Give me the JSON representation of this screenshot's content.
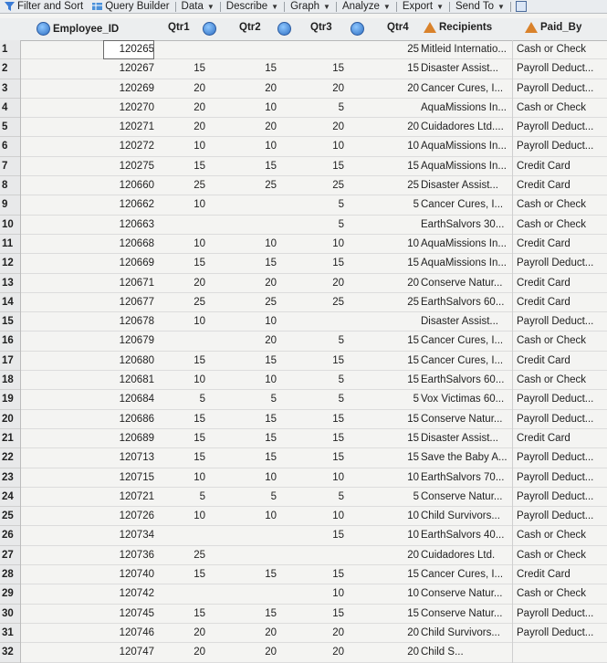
{
  "toolbar": {
    "items": [
      "Filter and Sort",
      "Query Builder",
      "Data",
      "Describe",
      "Graph",
      "Analyze",
      "Export",
      "Send To"
    ],
    "icons": [
      "filter-icon",
      "query-builder-icon",
      "",
      "",
      "",
      "",
      "",
      "",
      "window-icon"
    ]
  },
  "columns": [
    "Employee_ID",
    "Qtr1",
    "Qtr2",
    "Qtr3",
    "Qtr4",
    "Recipients",
    "Paid_By"
  ],
  "rows": [
    {
      "n": "1",
      "emp": "120265",
      "q1": "",
      "q2": "",
      "q3": "",
      "q4": "25",
      "rec": "Mitleid Internatio...",
      "paid": "Cash or Check"
    },
    {
      "n": "2",
      "emp": "120267",
      "q1": "15",
      "q2": "15",
      "q3": "15",
      "q4": "15",
      "rec": "Disaster Assist...",
      "paid": "Payroll Deduct..."
    },
    {
      "n": "3",
      "emp": "120269",
      "q1": "20",
      "q2": "20",
      "q3": "20",
      "q4": "20",
      "rec": "Cancer Cures, I...",
      "paid": "Payroll Deduct..."
    },
    {
      "n": "4",
      "emp": "120270",
      "q1": "20",
      "q2": "10",
      "q3": "5",
      "q4": "",
      "rec": "AquaMissions In...",
      "paid": "Cash or Check"
    },
    {
      "n": "5",
      "emp": "120271",
      "q1": "20",
      "q2": "20",
      "q3": "20",
      "q4": "20",
      "rec": "Cuidadores Ltd....",
      "paid": "Payroll Deduct..."
    },
    {
      "n": "6",
      "emp": "120272",
      "q1": "10",
      "q2": "10",
      "q3": "10",
      "q4": "10",
      "rec": "AquaMissions In...",
      "paid": "Payroll Deduct..."
    },
    {
      "n": "7",
      "emp": "120275",
      "q1": "15",
      "q2": "15",
      "q3": "15",
      "q4": "15",
      "rec": "AquaMissions In...",
      "paid": "Credit Card"
    },
    {
      "n": "8",
      "emp": "120660",
      "q1": "25",
      "q2": "25",
      "q3": "25",
      "q4": "25",
      "rec": "Disaster Assist...",
      "paid": "Credit Card"
    },
    {
      "n": "9",
      "emp": "120662",
      "q1": "10",
      "q2": "",
      "q3": "5",
      "q4": "5",
      "rec": "Cancer Cures, I...",
      "paid": "Cash or Check"
    },
    {
      "n": "10",
      "emp": "120663",
      "q1": "",
      "q2": "",
      "q3": "5",
      "q4": "",
      "rec": "EarthSalvors 30...",
      "paid": "Cash or Check"
    },
    {
      "n": "11",
      "emp": "120668",
      "q1": "10",
      "q2": "10",
      "q3": "10",
      "q4": "10",
      "rec": "AquaMissions In...",
      "paid": "Credit Card"
    },
    {
      "n": "12",
      "emp": "120669",
      "q1": "15",
      "q2": "15",
      "q3": "15",
      "q4": "15",
      "rec": "AquaMissions In...",
      "paid": "Payroll Deduct..."
    },
    {
      "n": "13",
      "emp": "120671",
      "q1": "20",
      "q2": "20",
      "q3": "20",
      "q4": "20",
      "rec": "Conserve Natur...",
      "paid": "Credit Card"
    },
    {
      "n": "14",
      "emp": "120677",
      "q1": "25",
      "q2": "25",
      "q3": "25",
      "q4": "25",
      "rec": "EarthSalvors 60...",
      "paid": "Credit Card"
    },
    {
      "n": "15",
      "emp": "120678",
      "q1": "10",
      "q2": "10",
      "q3": "",
      "q4": "",
      "rec": "Disaster Assist...",
      "paid": "Payroll Deduct..."
    },
    {
      "n": "16",
      "emp": "120679",
      "q1": "",
      "q2": "20",
      "q3": "5",
      "q4": "15",
      "rec": "Cancer Cures, I...",
      "paid": "Cash or Check"
    },
    {
      "n": "17",
      "emp": "120680",
      "q1": "15",
      "q2": "15",
      "q3": "15",
      "q4": "15",
      "rec": "Cancer Cures, I...",
      "paid": "Credit Card"
    },
    {
      "n": "18",
      "emp": "120681",
      "q1": "10",
      "q2": "10",
      "q3": "5",
      "q4": "15",
      "rec": "EarthSalvors 60...",
      "paid": "Cash or Check"
    },
    {
      "n": "19",
      "emp": "120684",
      "q1": "5",
      "q2": "5",
      "q3": "5",
      "q4": "5",
      "rec": "Vox Victimas 60...",
      "paid": "Payroll Deduct..."
    },
    {
      "n": "20",
      "emp": "120686",
      "q1": "15",
      "q2": "15",
      "q3": "15",
      "q4": "15",
      "rec": "Conserve Natur...",
      "paid": "Payroll Deduct..."
    },
    {
      "n": "21",
      "emp": "120689",
      "q1": "15",
      "q2": "15",
      "q3": "15",
      "q4": "15",
      "rec": "Disaster Assist...",
      "paid": "Credit Card"
    },
    {
      "n": "22",
      "emp": "120713",
      "q1": "15",
      "q2": "15",
      "q3": "15",
      "q4": "15",
      "rec": "Save the Baby A...",
      "paid": "Payroll Deduct..."
    },
    {
      "n": "23",
      "emp": "120715",
      "q1": "10",
      "q2": "10",
      "q3": "10",
      "q4": "10",
      "rec": "EarthSalvors 70...",
      "paid": "Payroll Deduct..."
    },
    {
      "n": "24",
      "emp": "120721",
      "q1": "5",
      "q2": "5",
      "q3": "5",
      "q4": "5",
      "rec": "Conserve Natur...",
      "paid": "Payroll Deduct..."
    },
    {
      "n": "25",
      "emp": "120726",
      "q1": "10",
      "q2": "10",
      "q3": "10",
      "q4": "10",
      "rec": "Child Survivors...",
      "paid": "Payroll Deduct..."
    },
    {
      "n": "26",
      "emp": "120734",
      "q1": "",
      "q2": "",
      "q3": "15",
      "q4": "10",
      "rec": "EarthSalvors 40...",
      "paid": "Cash or Check"
    },
    {
      "n": "27",
      "emp": "120736",
      "q1": "25",
      "q2": "",
      "q3": "",
      "q4": "20",
      "rec": "Cuidadores Ltd.",
      "paid": "Cash or Check"
    },
    {
      "n": "28",
      "emp": "120740",
      "q1": "15",
      "q2": "15",
      "q3": "15",
      "q4": "15",
      "rec": "Cancer Cures, I...",
      "paid": "Credit Card"
    },
    {
      "n": "29",
      "emp": "120742",
      "q1": "",
      "q2": "",
      "q3": "10",
      "q4": "10",
      "rec": "Conserve Natur...",
      "paid": "Cash or Check"
    },
    {
      "n": "30",
      "emp": "120745",
      "q1": "15",
      "q2": "15",
      "q3": "15",
      "q4": "15",
      "rec": "Conserve Natur...",
      "paid": "Payroll Deduct..."
    },
    {
      "n": "31",
      "emp": "120746",
      "q1": "20",
      "q2": "20",
      "q3": "20",
      "q4": "20",
      "rec": "Child Survivors...",
      "paid": "Payroll Deduct..."
    },
    {
      "n": "32",
      "emp": "120747",
      "q1": "20",
      "q2": "20",
      "q3": "20",
      "q4": "20",
      "rec": "Child S...",
      "paid": ""
    }
  ]
}
